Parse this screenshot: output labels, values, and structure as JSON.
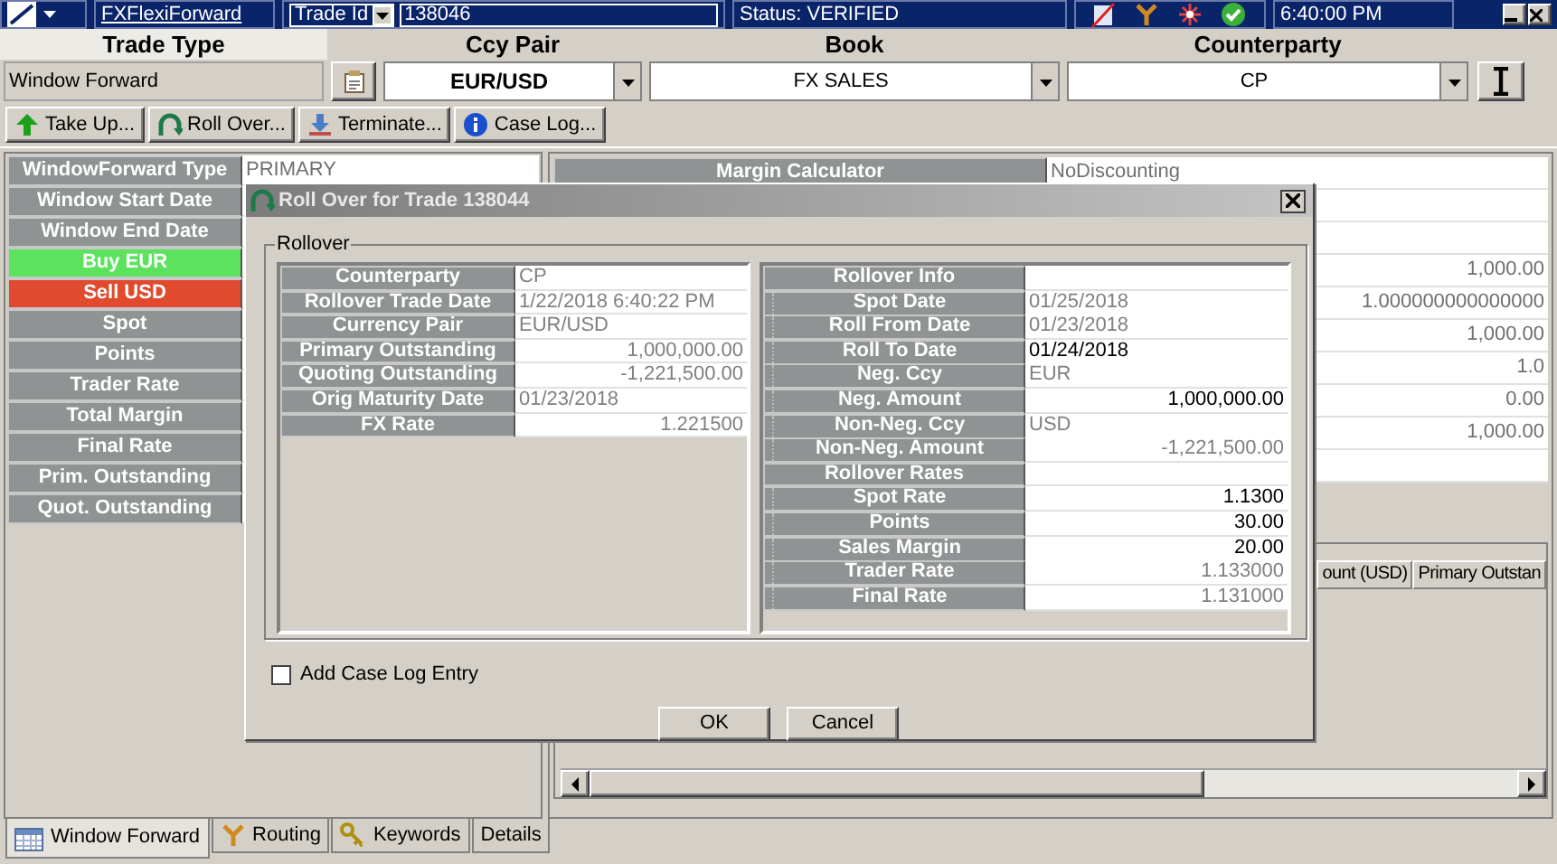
{
  "top_bar": {
    "app_link": "FXFlexiForward",
    "id_type": "Trade Id",
    "trade_id": "138046",
    "status": "Status: VERIFIED",
    "time": "6:40:00 PM"
  },
  "trade_header": [
    {
      "label": "Trade Type",
      "value": "Window Forward",
      "kind": "text",
      "bold": false
    },
    {
      "label": "Ccy Pair",
      "value": "EUR/USD",
      "kind": "combo",
      "bold": true
    },
    {
      "label": "Book",
      "value": "FX SALES",
      "kind": "combo",
      "bold": false
    },
    {
      "label": "Counterparty",
      "value": "CP",
      "kind": "combo",
      "bold": false
    }
  ],
  "toolbar": [
    {
      "label": "Take Up...",
      "kind": "up"
    },
    {
      "label": "Roll Over...",
      "kind": "rollover"
    },
    {
      "label": "Terminate...",
      "kind": "download"
    },
    {
      "label": "Case Log...",
      "kind": "info"
    }
  ],
  "left_panel": [
    {
      "label": "WindowForward Type",
      "value": "PRIMARY"
    },
    {
      "label": "Window Start Date"
    },
    {
      "label": "Window End Date"
    },
    {
      "label": "Buy EUR",
      "color": "#5de25d"
    },
    {
      "label": "Sell USD",
      "color": "#e04a2e"
    },
    {
      "label": "Spot"
    },
    {
      "label": "Points"
    },
    {
      "label": "Trader Rate"
    },
    {
      "label": "Total Margin"
    },
    {
      "label": "Final Rate"
    },
    {
      "label": "Prim. Outstanding"
    },
    {
      "label": "Quot. Outstanding"
    }
  ],
  "right_panel": [
    {
      "kind": "row",
      "label": "Margin Calculator",
      "value": "NoDiscounting"
    },
    {
      "kind": "blank"
    },
    {
      "kind": "blank"
    },
    {
      "kind": "row",
      "value": "1,000.00"
    },
    {
      "kind": "row",
      "value": "1.000000000000000"
    },
    {
      "kind": "row",
      "value": "1,000.00"
    },
    {
      "kind": "row",
      "value": "1.0"
    },
    {
      "kind": "row",
      "value": "0.00"
    },
    {
      "kind": "row",
      "value": "1,000.00"
    },
    {
      "kind": "blank"
    }
  ],
  "lower_table": {
    "columns": [
      "ount (USD)",
      "Primary Outstan"
    ]
  },
  "bottom_tabs": [
    {
      "label": "Window Forward",
      "kind": "calendar",
      "selected": true
    },
    {
      "label": "Routing",
      "kind": "fork",
      "selected": false
    },
    {
      "label": "Keywords",
      "kind": "keys",
      "selected": false
    },
    {
      "label": "Details",
      "kind": "plain",
      "selected": false
    }
  ],
  "dialog": {
    "title": "Roll Over for Trade 138044",
    "group_label": "Rollover",
    "left_table": [
      {
        "label": "Counterparty",
        "value": "CP",
        "kind": "text",
        "editable": false
      },
      {
        "label": "Rollover Trade Date",
        "value": "1/22/2018 6:40:22 PM",
        "kind": "text",
        "editable": false
      },
      {
        "label": "Currency Pair",
        "value": "EUR/USD",
        "kind": "text",
        "editable": false
      },
      {
        "label": "Primary Outstanding",
        "value": "1,000,000.00",
        "kind": "number",
        "editable": false
      },
      {
        "label": "Quoting Outstanding",
        "value": "-1,221,500.00",
        "kind": "number",
        "editable": false
      },
      {
        "label": "Orig Maturity Date",
        "value": "01/23/2018",
        "kind": "text",
        "editable": false
      },
      {
        "label": "FX Rate",
        "value": "1.221500",
        "kind": "number",
        "editable": false
      }
    ],
    "right_table": [
      {
        "label": "Rollover Info",
        "children": [
          {
            "label": "Spot Date",
            "value": "01/25/2018",
            "kind": "text",
            "editable": false
          },
          {
            "label": "Roll From Date",
            "value": "01/23/2018",
            "kind": "text",
            "editable": false
          },
          {
            "label": "Roll To Date",
            "value": "01/24/2018",
            "kind": "text",
            "editable": true
          },
          {
            "label": "Neg. Ccy",
            "value": "EUR",
            "kind": "text",
            "editable": false
          },
          {
            "label": "Neg. Amount",
            "value": "1,000,000.00",
            "kind": "number",
            "editable": true
          },
          {
            "label": "Non-Neg. Ccy",
            "value": "USD",
            "kind": "text",
            "editable": false
          },
          {
            "label": "Non-Neg. Amount",
            "value": "-1,221,500.00",
            "kind": "number",
            "editable": false
          }
        ]
      },
      {
        "label": "Rollover Rates",
        "children": [
          {
            "label": "Spot Rate",
            "value": "1.1300",
            "kind": "number",
            "editable": true
          },
          {
            "label": "Points",
            "value": "30.00",
            "kind": "number",
            "editable": true
          },
          {
            "label": "Sales Margin",
            "value": "20.00",
            "kind": "number",
            "editable": true
          },
          {
            "label": "Trader Rate",
            "value": "1.133000",
            "kind": "number",
            "editable": false
          },
          {
            "label": "Final Rate",
            "value": "1.131000",
            "kind": "number",
            "editable": false
          }
        ]
      }
    ],
    "checkbox": {
      "label": "Add Case Log Entry",
      "checked": false
    },
    "buttons": [
      "OK",
      "Cancel"
    ]
  }
}
